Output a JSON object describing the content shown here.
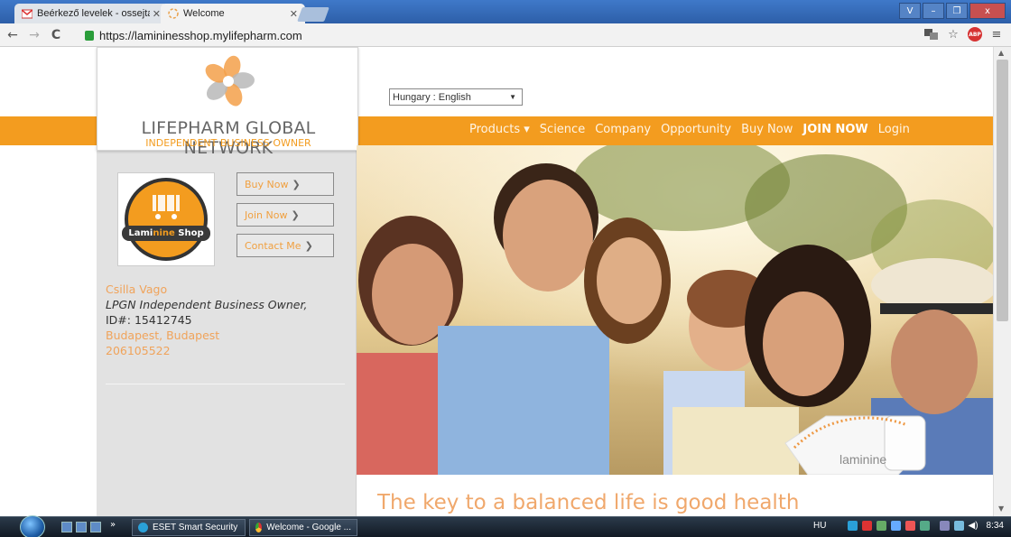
{
  "browser": {
    "tabs": [
      {
        "title": "Beérkező levelek - ossejtal",
        "icon": "gmail-icon"
      },
      {
        "title": "Welcome",
        "icon": "flower-icon"
      }
    ],
    "window_buttons": {
      "user": "V",
      "minimize": "–",
      "maximize": "❐",
      "close": "x"
    },
    "url": "https://lamininesshop.mylifepharm.com"
  },
  "page": {
    "language_select": "Hungary : English",
    "logo": {
      "title": "LIFEPHARM GLOBAL NETWORK",
      "subtitle": "INDEPENDENT BUSINESS OWNER"
    },
    "nav": [
      "Products ▾",
      "Science",
      "Company",
      "Opportunity",
      "Buy Now",
      "JOIN NOW",
      "Login"
    ],
    "shop_logo_text": {
      "part1": "Lami",
      "part2": "nine",
      "part3": "Shop"
    },
    "side_buttons": [
      "Buy Now",
      "Join Now",
      "Contact Me"
    ],
    "owner": {
      "name": "Csilla Vago",
      "role": "LPGN Independent Business Owner,",
      "id": "ID#: 15412745",
      "city": "Budapest, Budapest",
      "phone": "206105522"
    },
    "tagline": "The key to a balanced life is good health",
    "product_label": "laminine"
  },
  "taskbar": {
    "tasks": [
      "ESET Smart Security",
      "Welcome - Google ..."
    ],
    "lang": "HU",
    "clock": "8:34"
  },
  "colors": {
    "accent": "#f39c1f",
    "sidebar": "#e2e2e2"
  }
}
